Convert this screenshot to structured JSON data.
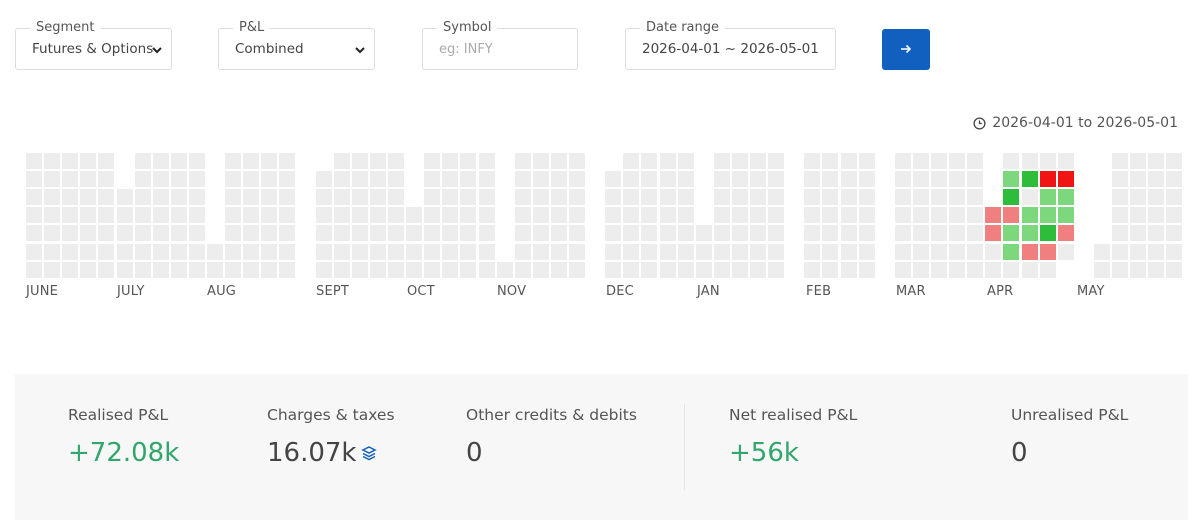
{
  "filters": {
    "segment": {
      "label": "Segment",
      "value": "Futures & Options"
    },
    "pnl": {
      "label": "P&L",
      "value": "Combined"
    },
    "symbol": {
      "label": "Symbol",
      "placeholder": "eg: INFY"
    },
    "date_range": {
      "label": "Date range",
      "value": "2026-04-01 ~ 2026-05-01"
    }
  },
  "range_caption": "2026-04-01 to 2026-05-01",
  "colors": {
    "empty": "#ededed",
    "green_light": "#7dd87d",
    "green_dark": "#2ebd3b",
    "red_light": "#f08080",
    "red_dark": "#f01414",
    "accent": "#1160c0",
    "positive_text": "#31a66b"
  },
  "heatmap": {
    "months": [
      "JUNE",
      "JULY",
      "AUG",
      "SEPT",
      "OCT",
      "NOV",
      "DEC",
      "JAN",
      "FEB",
      "MAR",
      "APR",
      "MAY"
    ]
  },
  "summary": {
    "realised": {
      "label": "Realised P&L",
      "value": "+72.08k"
    },
    "charges": {
      "label": "Charges & taxes",
      "value": "16.07k"
    },
    "other": {
      "label": "Other credits & debits",
      "value": "0"
    },
    "net": {
      "label": "Net realised P&L",
      "value": "+56k"
    },
    "unrealised": {
      "label": "Unrealised P&L",
      "value": "0"
    }
  }
}
